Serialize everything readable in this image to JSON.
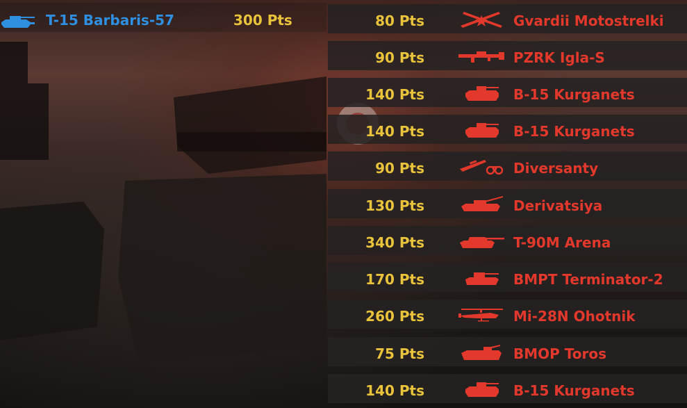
{
  "player": {
    "unit_name": "T-15 Barbaris-57",
    "points": "300 Pts",
    "icon": "blue-tank-icon",
    "color": "#2f8fe0"
  },
  "points_color": "#e9c33b",
  "enemy_color": "#e3382c",
  "kills": [
    {
      "points": "80 Pts",
      "name": "Gvardii Motostrelki",
      "icon": "crossed-rifles-star-icon"
    },
    {
      "points": "90 Pts",
      "name": "PZRK Igla-S",
      "icon": "launcher-icon"
    },
    {
      "points": "140 Pts",
      "name": "B-15 Kurganets",
      "icon": "ifv-icon"
    },
    {
      "points": "140 Pts",
      "name": "B-15 Kurganets",
      "icon": "ifv-icon"
    },
    {
      "points": "90 Pts",
      "name": "Diversanty",
      "icon": "rifle-binoculars-icon"
    },
    {
      "points": "130 Pts",
      "name": "Derivatsiya",
      "icon": "spaa-icon"
    },
    {
      "points": "340 Pts",
      "name": "T-90M Arena",
      "icon": "tank-icon"
    },
    {
      "points": "170 Pts",
      "name": "BMPT Terminator-2",
      "icon": "tank-support-icon"
    },
    {
      "points": "260 Pts",
      "name": "Mi-28N Ohotnik",
      "icon": "helicopter-icon"
    },
    {
      "points": "75 Pts",
      "name": "BMOP Toros",
      "icon": "apc-icon"
    },
    {
      "points": "140 Pts",
      "name": "B-15 Kurganets",
      "icon": "ifv-icon"
    }
  ]
}
